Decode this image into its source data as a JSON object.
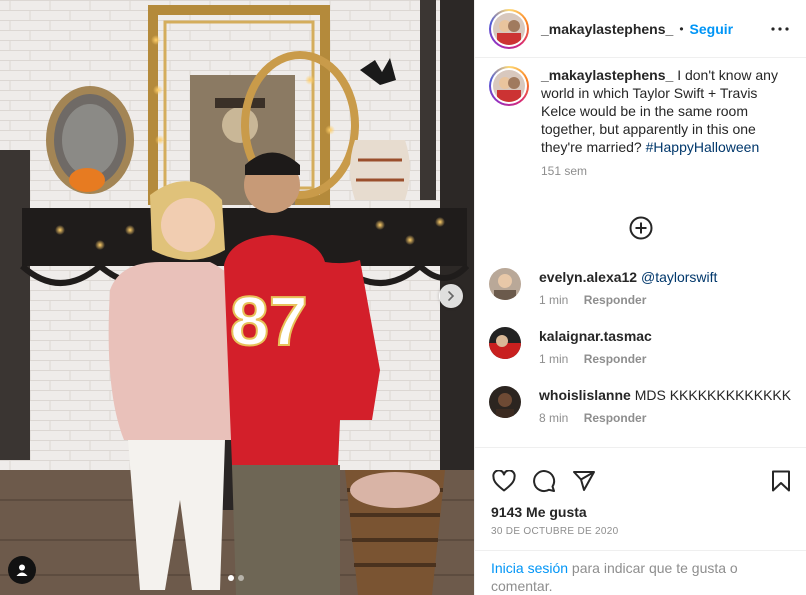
{
  "post": {
    "username": "_makaylastephens_",
    "separator": "•",
    "follow_label": "Seguir",
    "caption_text": "I don't know any world in which Taylor Swift + Travis Kelce would be in the same room together, but apparently in this one they're married?",
    "hashtag": "#HappyHalloween",
    "time_ago": "151 sem",
    "likes": "9143 Me gusta",
    "date": "30 DE OCTUBRE DE 2020",
    "login_link": "Inicia sesión",
    "login_rest": " para indicar que te gusta o comentar."
  },
  "comments": [
    {
      "username": "evelyn.alexa12",
      "text": "",
      "mention": "@taylorswift",
      "time": "1 min",
      "reply_label": "Responder"
    },
    {
      "username": "kalaignar.tasmac",
      "text": "",
      "mention": "",
      "time": "1 min",
      "reply_label": "Responder"
    },
    {
      "username": "whoislislanne",
      "text": "MDS KKKKKKKKKKKKK",
      "mention": "",
      "time": "8 min",
      "reply_label": "Responder"
    }
  ],
  "photo": {
    "jersey_number": "87",
    "carousel_count": 2,
    "carousel_active": 1
  },
  "icons": {
    "more": "more-options-icon",
    "load_more": "plus-circle-icon",
    "like": "heart-icon",
    "comment": "comment-icon",
    "share": "paper-plane-icon",
    "save": "bookmark-icon",
    "next": "chevron-right-icon",
    "tags": "user-tag-icon"
  },
  "colors": {
    "accent": "#0095f6",
    "hashtag": "#00376b",
    "muted": "#8e8e8e",
    "jersey": "#d31f2a"
  }
}
